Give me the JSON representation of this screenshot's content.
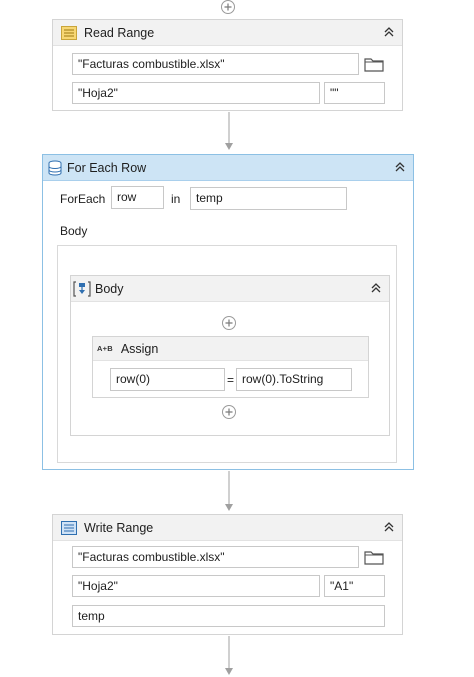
{
  "read_range": {
    "title": "Read Range",
    "workbook_path": "\"Facturas combustible.xlsx\"",
    "sheet_name": "\"Hoja2\"",
    "range": "\"\""
  },
  "for_each_row": {
    "title": "For Each Row",
    "foreach_label": "ForEach",
    "item_variable": "row",
    "in_label": "in",
    "datatable": "temp",
    "body_label": "Body"
  },
  "body_sequence": {
    "title": "Body"
  },
  "assign": {
    "title": "Assign",
    "icon_text": "A+B",
    "to": "row(0)",
    "equals": "=",
    "value": "row(0).ToString"
  },
  "write_range": {
    "title": "Write Range",
    "workbook_path": "\"Facturas combustible.xlsx\"",
    "sheet_name": "\"Hoja2\"",
    "starting_cell": "\"A1\"",
    "datatable": "temp"
  },
  "colors": {
    "selected_header": "#cde4f5",
    "selected_border": "#8cc0e4",
    "header_gray": "#f2f2f2",
    "border_gray": "#d4d4d4",
    "connector": "#a0a0a0"
  },
  "icons": {
    "read_range": "excel-read-range-icon",
    "for_each_row": "database-rows-icon",
    "body": "sequence-icon",
    "assign": "assign-icon",
    "write_range": "excel-write-range-icon",
    "collapse": "chevron-double-up-icon",
    "folder": "folder-icon",
    "add": "add-activity-icon"
  }
}
